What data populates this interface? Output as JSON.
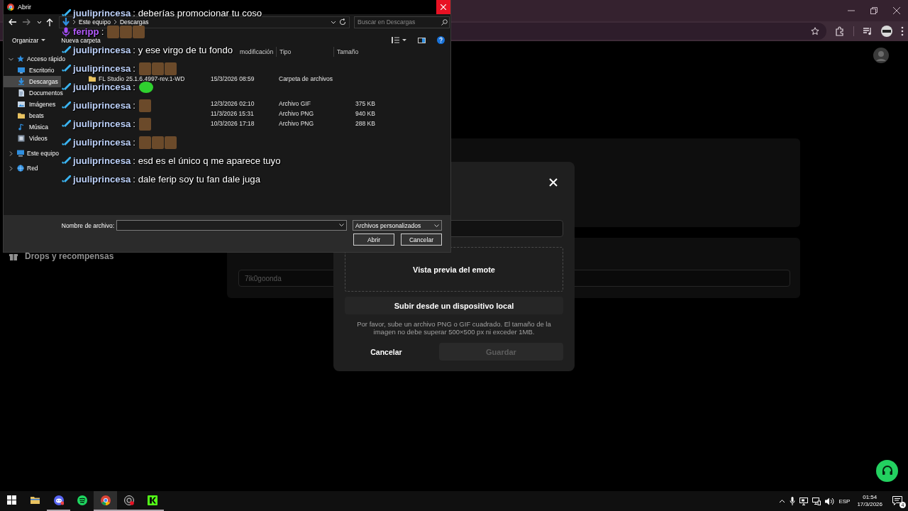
{
  "page": {
    "sidebar": [
      {
        "label": "Drops y recompensas"
      }
    ],
    "field": {
      "placeholder": "7ik0goonda"
    }
  },
  "emote_modal": {
    "preview_label": "Vista previa del emote",
    "upload_button": "Subir desde un dispositivo local",
    "help_text": "Por favor, sube un archivo PNG o GIF cuadrado. El tamaño de la imagen no debe superar 500×500 px ni exceder 1MB.",
    "cancel_button": "Cancelar",
    "save_button": {
      "label": "Guardar",
      "disabled": true
    }
  },
  "file_dialog": {
    "title": "Abrir",
    "breadcrumb": [
      "Este equipo",
      "Descargas"
    ],
    "search": {
      "placeholder": "Buscar en Descargas"
    },
    "toolbar": [
      "Organizar",
      "Nueva carpeta"
    ],
    "nav_tree": [
      {
        "label": "Acceso rápido",
        "kind": "star",
        "expanded": true,
        "selected": false,
        "children": [
          {
            "label": "Escritorio",
            "kind": "desktop",
            "selected": false
          },
          {
            "label": "Descargas",
            "kind": "download",
            "selected": true
          },
          {
            "label": "Documentos",
            "kind": "document",
            "selected": false
          },
          {
            "label": "Imágenes",
            "kind": "image",
            "selected": false
          },
          {
            "label": "beats",
            "kind": "folder",
            "selected": false
          },
          {
            "label": "Música",
            "kind": "music",
            "selected": false
          },
          {
            "label": "Videos",
            "kind": "video",
            "selected": false
          }
        ]
      },
      {
        "label": "Este equipo",
        "kind": "computer",
        "expanded": false,
        "selected": false
      },
      {
        "label": "Red",
        "kind": "network",
        "expanded": false,
        "selected": false
      }
    ],
    "columns": [
      "modificación",
      "Tipo",
      "Tamaño"
    ],
    "file_groups": [
      {
        "files": [
          {
            "name": "FL Studio 25.1.6.4997-rev.1-WD",
            "date": "15/3/2026 08:59",
            "type": "Carpeta de archivos"
          }
        ]
      },
      {
        "files": [
          {
            "date": "12/3/2026 02:10",
            "type": "Archivo GIF",
            "size": "375 KB"
          },
          {
            "date": "11/3/2026 15:31",
            "type": "Archivo PNG",
            "size": "940 KB"
          },
          {
            "date": "10/3/2026 17:18",
            "type": "Archivo PNG",
            "size": "288 KB"
          }
        ]
      }
    ],
    "filename_label": "Nombre de archivo:",
    "file_type": "Archivos personalizados",
    "buttons": [
      "Abrir",
      "Cancelar"
    ]
  },
  "chat": {
    "messages": [
      {
        "user": "juuliprincesa",
        "color": "#bcd0f8",
        "kind": "sword",
        "text": ": deberías promocionar tu coso"
      },
      {
        "user": "feripp",
        "color": "#b45cff",
        "kind": "mic",
        "text": ":",
        "emotes": [
          {
            "kind": "photo"
          },
          {
            "kind": "photo"
          },
          {
            "kind": "photo"
          }
        ]
      },
      {
        "user": "juuliprincesa",
        "color": "#bcd0f8",
        "kind": "sword",
        "text": ": y ese virgo de tu fondo"
      },
      {
        "user": "juuliprincesa",
        "color": "#bcd0f8",
        "kind": "sword",
        "text": ":",
        "emotes": [
          {
            "kind": "photo"
          },
          {
            "kind": "photo"
          },
          {
            "kind": "photo"
          }
        ]
      },
      {
        "user": "juuliprincesa",
        "color": "#bcd0f8",
        "kind": "sword",
        "text": ":",
        "emotes": [
          {
            "kind": "blob"
          }
        ]
      },
      {
        "user": "juuliprincesa",
        "color": "#bcd0f8",
        "kind": "sword",
        "text": ":",
        "emotes": [
          {
            "kind": "photo"
          }
        ]
      },
      {
        "user": "juuliprincesa",
        "color": "#bcd0f8",
        "kind": "sword",
        "text": ":",
        "emotes": [
          {
            "kind": "photo"
          }
        ]
      },
      {
        "user": "juuliprincesa",
        "color": "#bcd0f8",
        "kind": "sword",
        "text": ":",
        "emotes": [
          {
            "kind": "photo"
          },
          {
            "kind": "photo"
          },
          {
            "kind": "photo"
          }
        ]
      },
      {
        "user": "juuliprincesa",
        "color": "#bcd0f8",
        "kind": "sword",
        "text": ": esd es el único q me aparece tuyo"
      },
      {
        "user": "juuliprincesa",
        "color": "#bcd0f8",
        "kind": "sword",
        "text": ": dale ferip soy tu fan dale juga"
      }
    ]
  },
  "taskbar": {
    "apps": [
      {
        "kind": "start",
        "active": false,
        "running": false
      },
      {
        "kind": "explorer",
        "active": false,
        "running": false
      },
      {
        "kind": "discord",
        "active": false,
        "running": true
      },
      {
        "kind": "spotify",
        "active": false,
        "running": false
      },
      {
        "kind": "chrome",
        "active": true,
        "running": true
      },
      {
        "kind": "obs",
        "active": false,
        "running": true
      },
      {
        "kind": "kick",
        "active": false,
        "running": true
      }
    ],
    "tray": {
      "language": "ESP",
      "time": "01:54",
      "date": "17/3/2026",
      "notifications": "4"
    }
  }
}
